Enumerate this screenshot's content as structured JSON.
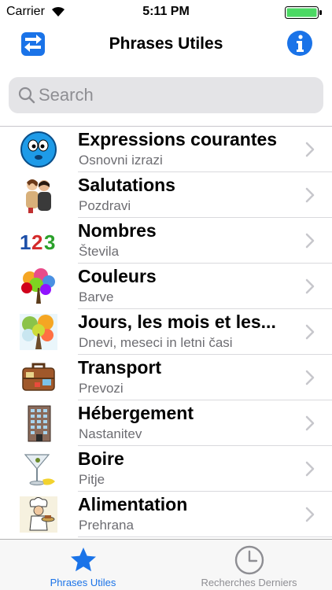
{
  "status_bar": {
    "carrier": "Carrier",
    "time": "5:11 PM"
  },
  "nav": {
    "title": "Phrases Utiles",
    "left_icon": "swap-arrows-icon",
    "right_icon": "info-icon"
  },
  "search": {
    "placeholder": "Search",
    "value": ""
  },
  "list": {
    "items": [
      {
        "title": "Expressions courantes",
        "subtitle": "Osnovni izrazi",
        "icon": "smiley-face-icon"
      },
      {
        "title": "Salutations",
        "subtitle": "Pozdravi",
        "icon": "hugging-people-icon"
      },
      {
        "title": "Nombres",
        "subtitle": "Števila",
        "icon": "numbers-123-icon"
      },
      {
        "title": "Couleurs",
        "subtitle": "Barve",
        "icon": "colorful-tree-icon"
      },
      {
        "title": "Jours, les mois et les...",
        "subtitle": "Dnevi, meseci in letni časi",
        "icon": "seasons-tree-icon"
      },
      {
        "title": "Transport",
        "subtitle": "Prevozi",
        "icon": "suitcase-icon"
      },
      {
        "title": "Hébergement",
        "subtitle": "Nastanitev",
        "icon": "hotel-building-icon"
      },
      {
        "title": "Boire",
        "subtitle": "Pitje",
        "icon": "cocktail-glass-icon"
      },
      {
        "title": "Alimentation",
        "subtitle": "Prehrana",
        "icon": "chef-icon"
      }
    ]
  },
  "tab_bar": {
    "tabs": [
      {
        "label": "Phrases Utiles",
        "icon": "star-icon",
        "selected": true
      },
      {
        "label": "Recherches Derniers",
        "icon": "clock-icon",
        "selected": false
      }
    ]
  },
  "colors": {
    "accent": "#1a73e8",
    "battery": "#4cd964",
    "secondary_text": "#6d6d72"
  }
}
